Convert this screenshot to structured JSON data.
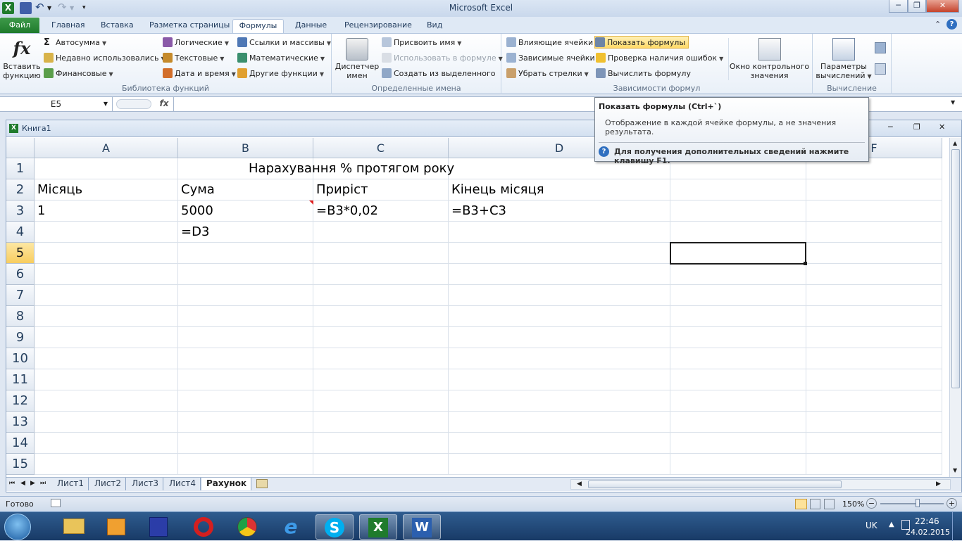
{
  "window": {
    "title": "Microsoft Excel"
  },
  "tabs": [
    "Файл",
    "Главная",
    "Вставка",
    "Разметка страницы",
    "Формулы",
    "Данные",
    "Рецензирование",
    "Вид"
  ],
  "ribbon": {
    "insert_function": {
      "line1": "Вставить",
      "line2": "функцию"
    },
    "library": {
      "label": "Библиотека функций",
      "col1": [
        "Автосумма",
        "Недавно использовались",
        "Финансовые"
      ],
      "col2": [
        "Логические",
        "Текстовые",
        "Дата и время"
      ],
      "col3": [
        "Ссылки и массивы",
        "Математические",
        "Другие функции"
      ]
    },
    "names": {
      "label": "Определенные имена",
      "manager": {
        "line1": "Диспетчер",
        "line2": "имен"
      },
      "items": [
        "Присвоить имя",
        "Использовать в формуле",
        "Создать из выделенного"
      ]
    },
    "audit": {
      "label": "Зависимости формул",
      "col1": [
        "Влияющие ячейки",
        "Зависимые ячейки",
        "Убрать стрелки"
      ],
      "col2": [
        "Показать формулы",
        "Проверка наличия ошибок",
        "Вычислить формулу"
      ],
      "watch": {
        "line1": "Окно контрольного",
        "line2": "значения"
      }
    },
    "calc": {
      "label": "Вычисление",
      "options": {
        "line1": "Параметры",
        "line2": "вычислений"
      }
    }
  },
  "formula_bar": {
    "name_box": "E5",
    "fx": "fx",
    "value": ""
  },
  "workbook": {
    "title": "Книга1",
    "columns": [
      "A",
      "B",
      "C",
      "D",
      "E",
      "F"
    ],
    "rows": [
      "1",
      "2",
      "3",
      "4",
      "5",
      "6",
      "7",
      "8",
      "9",
      "10",
      "11",
      "12",
      "13",
      "14",
      "15"
    ],
    "cells": {
      "B1": "Нарахування % протягом року",
      "A2": "Місяць",
      "B2": "Сума",
      "C2": "Приріст",
      "D2": "Кінець місяця",
      "A3": "1",
      "B3": "5000",
      "C3": "=B3*0,02",
      "D3": "=B3+C3",
      "B4": "=D3"
    },
    "selected": "E5",
    "sheets": [
      "Лист1",
      "Лист2",
      "Лист3",
      "Лист4",
      "Рахунок"
    ],
    "active_sheet": "Рахунок"
  },
  "tooltip": {
    "title": "Показать формулы (Ctrl+`)",
    "body": "Отображение в каждой ячейке формулы, а не значения результата.",
    "help": "Для получения дополнительных сведений нажмите клавишу F1."
  },
  "status": {
    "ready": "Готово",
    "zoom": "150%"
  },
  "taskbar": {
    "lang": "UK",
    "time": "22:46",
    "date": "24.02.2015"
  },
  "colors": {
    "excel_green": "#1f7b2c",
    "selection_header": "#f8cd5f",
    "ribbon_highlight": "#ffd967"
  }
}
